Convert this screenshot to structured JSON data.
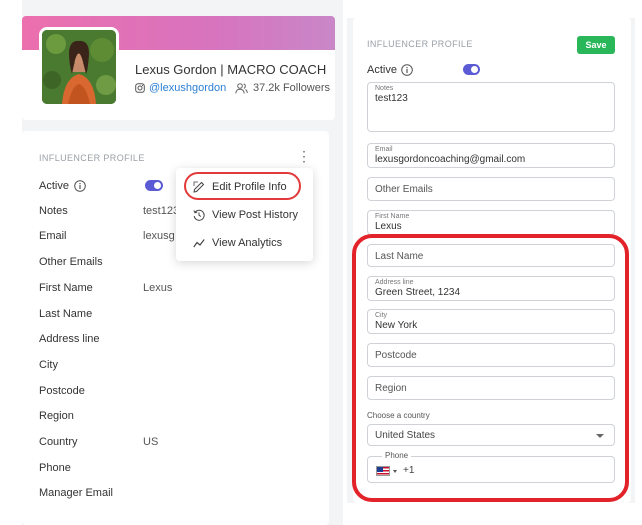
{
  "colors": {
    "accent": "#5b5bd6",
    "save": "#2ab75a",
    "highlight": "#e3232a",
    "link": "#2b7fd6"
  },
  "profile": {
    "name": "Lexus Gordon | MACRO COACH",
    "handle": "@lexushgordon",
    "followers": "37.2k Followers"
  },
  "left_card": {
    "section_title": "INFLUENCER PROFILE",
    "rows": [
      {
        "label": "Active",
        "value": ""
      },
      {
        "label": "Notes",
        "value": "test123"
      },
      {
        "label": "Email",
        "value": "lexusg"
      },
      {
        "label": "Other Emails",
        "value": ""
      },
      {
        "label": "First Name",
        "value": "Lexus"
      },
      {
        "label": "Last Name",
        "value": ""
      },
      {
        "label": "Address line",
        "value": ""
      },
      {
        "label": "City",
        "value": ""
      },
      {
        "label": "Postcode",
        "value": ""
      },
      {
        "label": "Region",
        "value": ""
      },
      {
        "label": "Country",
        "value": "US"
      },
      {
        "label": "Phone",
        "value": ""
      },
      {
        "label": "Manager Email",
        "value": ""
      }
    ],
    "menu": [
      {
        "label": "Edit Profile Info",
        "icon": "edit-icon"
      },
      {
        "label": "View Post History",
        "icon": "history-icon"
      },
      {
        "label": "View Analytics",
        "icon": "analytics-icon"
      }
    ]
  },
  "right_card": {
    "section_title": "INFLUENCER PROFILE",
    "save_label": "Save",
    "active_label": "Active",
    "fields": {
      "notes": {
        "label": "Notes",
        "value": "test123"
      },
      "email": {
        "label": "Email",
        "value": "lexusgordoncoaching@gmail.com"
      },
      "other_emails": {
        "placeholder": "Other Emails"
      },
      "first_name": {
        "label": "First Name",
        "value": "Lexus"
      },
      "last_name": {
        "placeholder": "Last Name"
      },
      "address": {
        "label": "Address line",
        "value": "Green Street, 1234"
      },
      "city": {
        "label": "City",
        "value": "New York"
      },
      "postcode": {
        "placeholder": "Postcode"
      },
      "region": {
        "placeholder": "Region"
      }
    },
    "country_label": "Choose a country",
    "country_value": "United States",
    "phone_label": "Phone",
    "phone_code": "+1"
  }
}
